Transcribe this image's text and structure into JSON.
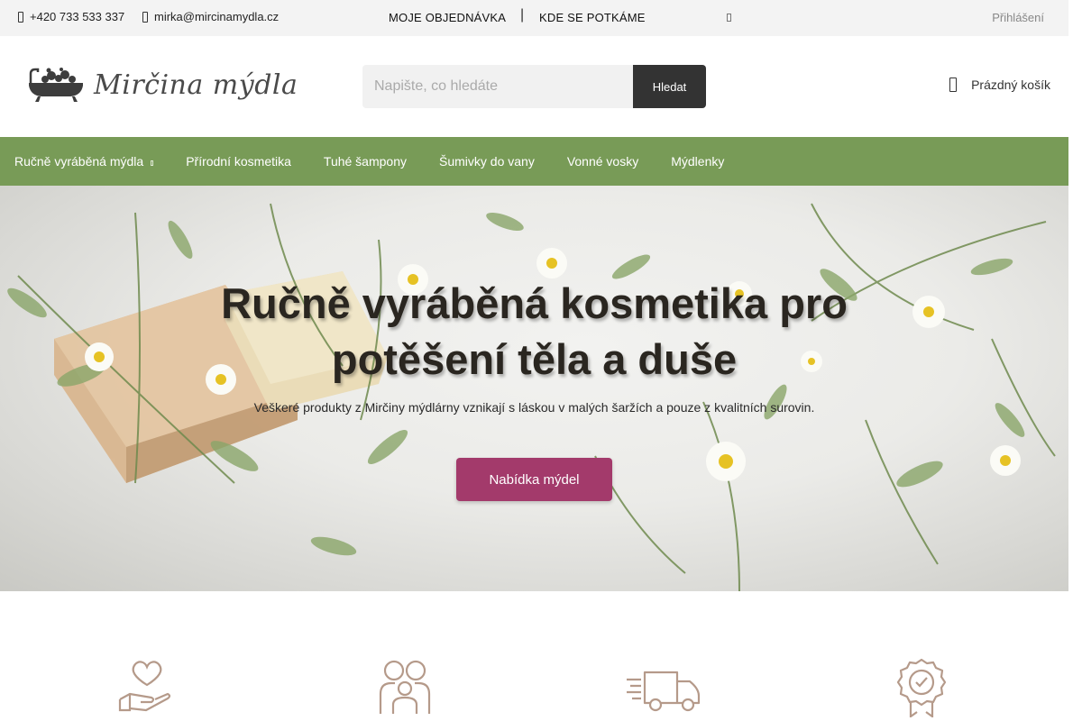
{
  "topbar": {
    "phone": "+420 733 533 337",
    "email": "mirka@mircinamydla.cz",
    "nav": [
      "MOJE OBJEDNÁVKA",
      "KDE SE POTKÁME"
    ],
    "separator": "|",
    "login": "Přihlášení"
  },
  "header": {
    "logo_text": "Mirčina mýdla",
    "search_placeholder": "Napište, co hledáte",
    "search_button": "Hledat",
    "cart_label": "Prázdný košík"
  },
  "menu": {
    "items": [
      "Ručně vyráběná mýdla",
      "Přírodní kosmetika",
      "Tuhé šampony",
      "Šumivky do vany",
      "Vonné vosky",
      "Mýdlenky"
    ]
  },
  "hero": {
    "title_line1": "Ručně vyráběná kosmetika pro",
    "title_line2": "potěšení těla a duše",
    "subtitle": "Veškeré produkty z Mirčiny mýdlárny vznikají s láskou v malých šaržích a pouze z kvalitních surovin.",
    "cta": "Nabídka mýdel"
  },
  "features": {
    "icons": [
      "heart-hand-icon",
      "family-icon",
      "delivery-truck-icon",
      "quality-badge-icon"
    ],
    "icon_color": "#b59a8a"
  },
  "colors": {
    "menu_bg": "#789b57",
    "cta_bg": "#a33a6b",
    "topbar_bg": "#f3f3f3"
  }
}
